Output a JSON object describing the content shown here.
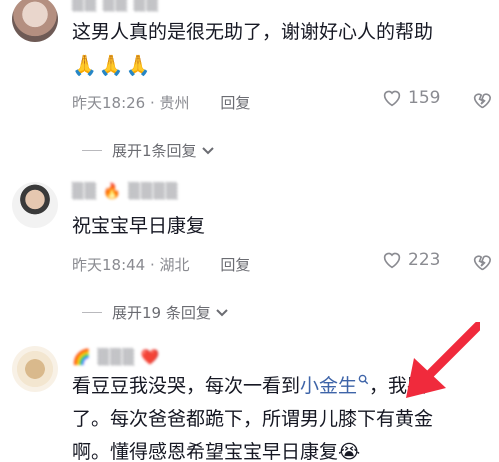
{
  "comments": [
    {
      "text": "这男人真的是很无助了，谢谢好心人的帮助",
      "emoji_row": "🙏🙏🙏",
      "time_location": "昨天18:26 · 贵州",
      "reply_label": "回复",
      "like_count": "159"
    },
    {
      "text": "祝宝宝早日康复",
      "time_location": "昨天18:44 · 湖北",
      "reply_label": "回复",
      "like_count": "223"
    },
    {
      "text_part1": "看豆豆我没哭，每次一看到",
      "link_text": "小金生",
      "text_part2": "，我哭了。每次爸爸都跪下，所谓男儿膝下有黄金啊。懂得感恩希望宝宝早日康复",
      "emoji_end": "😭"
    }
  ],
  "expanders": [
    {
      "label": "展开1条回复"
    },
    {
      "label": "展开19 条回复"
    }
  ],
  "colors": {
    "link": "#3e64a8",
    "arrow": "#f02a3c",
    "meta": "#8a8b91"
  }
}
